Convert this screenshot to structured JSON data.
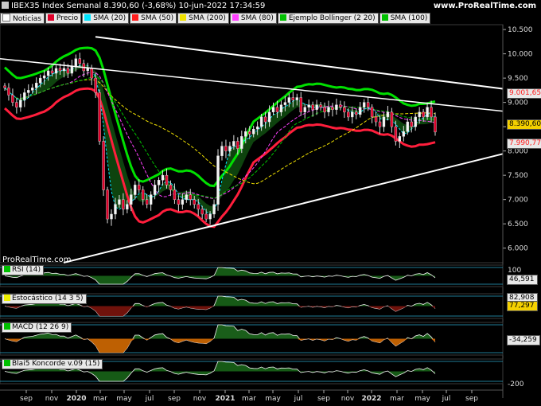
{
  "header": {
    "title": "IBEX35 Index Semanal 8.390,60 (-3,68%) 10-jun-2022 17:34:59",
    "site": "www.ProRealTime.com",
    "watermark": "ProRealTime.com"
  },
  "legend": {
    "items": [
      {
        "label": "Noticias",
        "color": "#ffffff"
      },
      {
        "label": "Precio",
        "color": "#e0002a"
      },
      {
        "label": "SMA (20)",
        "color": "#00e5ff"
      },
      {
        "label": "SMA (50)",
        "color": "#ff1e1e"
      },
      {
        "label": "SMA (200)",
        "color": "#f0e000"
      },
      {
        "label": "SMA (80)",
        "color": "#ff40ff"
      },
      {
        "label": "Ejemplo Bollinger (2 20)",
        "color": "#00c000"
      },
      {
        "label": "SMA (100)",
        "color": "#00c000"
      }
    ]
  },
  "panels": {
    "rsi": {
      "label": "RSI (14)",
      "value": "46,591",
      "level_top": "100"
    },
    "stoch": {
      "label": "Estocástico (14 3 5)",
      "value1": "82,908",
      "value2": "77,297"
    },
    "macd": {
      "label": "MACD (12 26 9)",
      "value": "-34,259"
    },
    "blai": {
      "label": "Blai5 Koncorde v.09 (15)",
      "level": "-200"
    }
  },
  "price_labels": [
    {
      "text": "9.001,65",
      "color": "#ff2020",
      "price": 9002
    },
    {
      "text": "8.390,60",
      "color": "#e8b800",
      "price": 8391
    },
    {
      "text": "7.990,77",
      "color": "#ff2020",
      "price": 7991
    }
  ],
  "chart_data": {
    "type": "candlestick",
    "title": "IBEX35 Index Semanal",
    "y_axis": {
      "ticks": [
        "10.500",
        "10.000",
        "9.500",
        "9.000",
        "8.500",
        "8.000",
        "7.500",
        "7.000",
        "6.500",
        "6.000"
      ],
      "values": [
        10500,
        10000,
        9500,
        9000,
        8500,
        8000,
        7500,
        7000,
        6500,
        6000
      ],
      "ylim": [
        5700,
        10600
      ]
    },
    "x_axis": {
      "ticks": [
        "sep",
        "nov",
        "2020",
        "mar",
        "may",
        "jul",
        "sep",
        "nov",
        "2021",
        "mar",
        "may",
        "jul",
        "sep",
        "nov",
        "2022",
        "mar",
        "may",
        "jul",
        "sep"
      ]
    },
    "last_close": 8390.6,
    "change_pct": -3.68,
    "series": [
      {
        "name": "Precio",
        "values": [
          9300,
          9150,
          9000,
          8900,
          9050,
          9200,
          9250,
          9300,
          9400,
          9500,
          9550,
          9650,
          9600,
          9700,
          9650,
          9700,
          9600,
          9750,
          9900,
          9800,
          9650,
          9700,
          9500,
          9200,
          8200,
          7200,
          6600,
          6700,
          6900,
          7000,
          6800,
          6900,
          7100,
          7300,
          7200,
          7000,
          6900,
          7100,
          7300,
          7400,
          7500,
          7300,
          7200,
          7000,
          6900,
          7000,
          7100,
          7000,
          6900,
          6800,
          6700,
          6600,
          6700,
          6900,
          7900,
          8100,
          8000,
          8100,
          8200,
          8050,
          8300,
          8400,
          8350,
          8450,
          8500,
          8700,
          8600,
          8800,
          8900,
          8800,
          8950,
          9000,
          9100,
          9050,
          9100,
          8800,
          8900,
          8950,
          8850,
          8950,
          8900,
          8800,
          8900,
          8850,
          8950,
          8900,
          8800,
          8700,
          8800,
          8750,
          8900,
          9000,
          8900,
          8700,
          8600,
          8500,
          8700,
          8800,
          8500,
          8200,
          8300,
          8400,
          8600,
          8500,
          8700,
          8800,
          8700,
          8900,
          8700,
          8390
        ]
      }
    ]
  }
}
